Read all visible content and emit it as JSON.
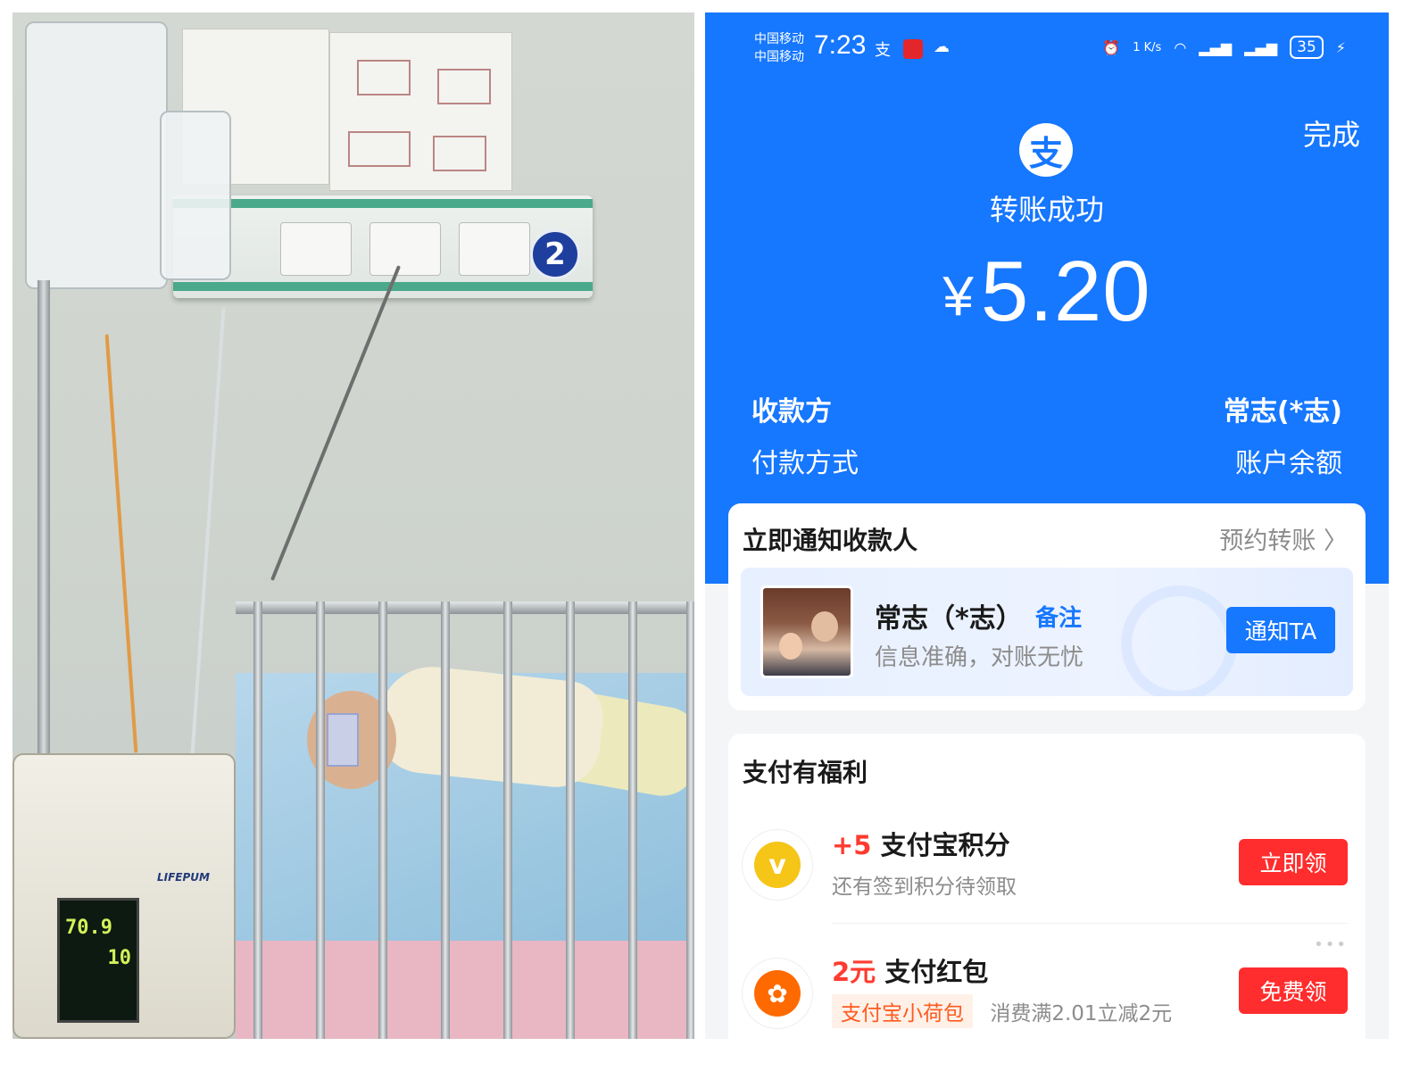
{
  "left_photo": {
    "bed_number": "2",
    "pump_brand": "LIFEPUM",
    "pump_reading_1": "70.9",
    "pump_reading_2": "10"
  },
  "status_bar": {
    "carrier_1": "中国移动",
    "carrier_2": "中国移动",
    "time": "7:23",
    "network_speed": "1 K/s",
    "battery": "35"
  },
  "header": {
    "done_label": "完成",
    "logo_char": "支",
    "status_text": "转账成功",
    "currency": "¥",
    "amount": "5.20"
  },
  "details": {
    "payee_label": "收款方",
    "payee_value": "常志(*志)",
    "method_label": "付款方式",
    "method_value": "账户余额"
  },
  "notify_card": {
    "title": "立即通知收款人",
    "schedule_label": "预约转账 〉",
    "payee_name": "常志（*志）",
    "remark_label": "备注",
    "subtitle": "信息准确，对账无忧",
    "button_label": "通知TA"
  },
  "benefits_card": {
    "title": "支付有福利",
    "items": [
      {
        "highlight": "+5",
        "title": "支付宝积分",
        "subtitle": "还有签到积分待领取",
        "button": "立即领",
        "icon": "v"
      },
      {
        "highlight": "2元",
        "title": "支付红包",
        "tag": "支付宝小荷包",
        "subtitle": "消费满2.01立减2元",
        "button": "免费领",
        "icon": "✿"
      }
    ]
  },
  "colors": {
    "alipay_blue": "#1677ff",
    "red_button": "#ff2d2d"
  }
}
